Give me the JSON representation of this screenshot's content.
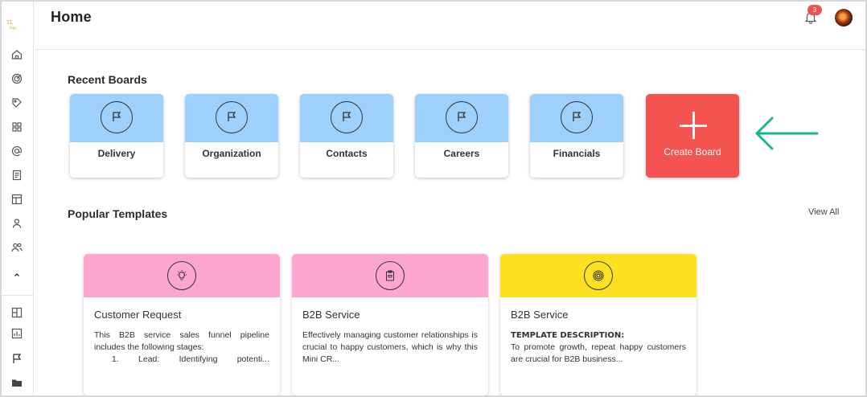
{
  "app": {
    "logo_text": "Logo",
    "page_title": "Home",
    "notifications_count": "3"
  },
  "sidebar": {
    "icons": [
      "home-icon",
      "target-icon",
      "tag-icon",
      "apps-icon",
      "at-icon",
      "document-icon",
      "dashboard-icon",
      "user-icon",
      "users-icon",
      "chevron-up-icon",
      "layout-icon",
      "chart-icon",
      "flag-icon",
      "folder-icon"
    ]
  },
  "recent_boards": {
    "title": "Recent Boards",
    "items": [
      {
        "label": "Delivery",
        "icon": "flag-icon"
      },
      {
        "label": "Organization",
        "icon": "flag-icon"
      },
      {
        "label": "Contacts",
        "icon": "flag-icon"
      },
      {
        "label": "Careers",
        "icon": "flag-icon"
      },
      {
        "label": "Financials",
        "icon": "flag-icon"
      }
    ],
    "create_label": "Create Board",
    "accent_color": "#9dd0fa",
    "create_color": "#f4534f",
    "arrow_color": "#1db489"
  },
  "popular_templates": {
    "title": "Popular Templates",
    "view_all": "View All",
    "items": [
      {
        "title": "Customer Request",
        "icon": "lightbulb-icon",
        "color": "#fda7d0",
        "desc_line1": "This B2B service sales funnel pipeline includes the following stages:",
        "desc_line2": "1. Lead: Identifying potenti..."
      },
      {
        "title": "B2B Service",
        "icon": "clipboard-icon",
        "color": "#fda7d0",
        "desc_line1": "Effectively managing customer relationships is crucial to happy customers, which is why this Mini CR..."
      },
      {
        "title": "B2B Service",
        "icon": "target-icon",
        "color": "#fde11f",
        "desc_heading": "TEMPLATE DESCRIPTION:",
        "desc_line1": "To promote growth, repeat happy customers are crucial for B2B business..."
      }
    ]
  }
}
